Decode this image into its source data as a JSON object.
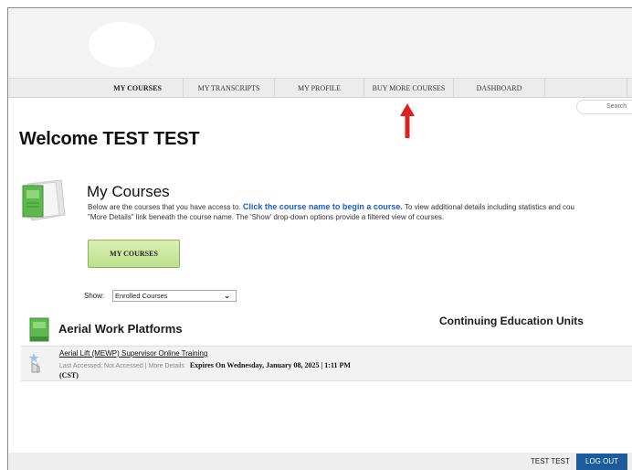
{
  "nav": {
    "items": [
      {
        "label": "MY COURSES",
        "active": true
      },
      {
        "label": "MY TRANSCRIPTS",
        "active": false
      },
      {
        "label": "MY PROFILE",
        "active": false
      },
      {
        "label": "BUY MORE COURSES",
        "active": false
      },
      {
        "label": "DASHBOARD",
        "active": false
      }
    ]
  },
  "search": {
    "label": "Search"
  },
  "welcome": {
    "title": "Welcome TEST TEST"
  },
  "my_courses": {
    "title": "My Courses",
    "desc_part1": "Below are the courses that you have access to. ",
    "desc_highlight": "Click the course name to begin a course.",
    "desc_part2": " To view additional details including statistics and cou",
    "desc_line2": "\"More Details\" link beneath the course name. The 'Show' drop-down options provide a filtered view of courses.",
    "button_label": "MY COURSES"
  },
  "show": {
    "label": "Show:",
    "selected": "Enrolled Courses"
  },
  "category": {
    "title": "Aerial Work Platforms",
    "ceu_title": "Continuing Education Units"
  },
  "course": {
    "name": "Aerial Lift (MEWP) Supervisor Online Training",
    "last_accessed": "Last Accessed: Not Accessed",
    "separator": "|",
    "more_details": "More Details",
    "expires": "Expires On Wednesday, January 08, 2025 | 1:11 PM",
    "timezone": "(CST)"
  },
  "footer": {
    "user": "TEST TEST",
    "logout": "LOG OUT"
  },
  "colors": {
    "accent": "#1b5bd6",
    "logout_bg": "#1c5c9c",
    "button_green": "#c8e89c",
    "arrow": "#e02020"
  },
  "icons": [
    "notebook-icon",
    "book-icon",
    "course-pin-icon",
    "chevron-down-icon",
    "red-arrow-icon"
  ]
}
